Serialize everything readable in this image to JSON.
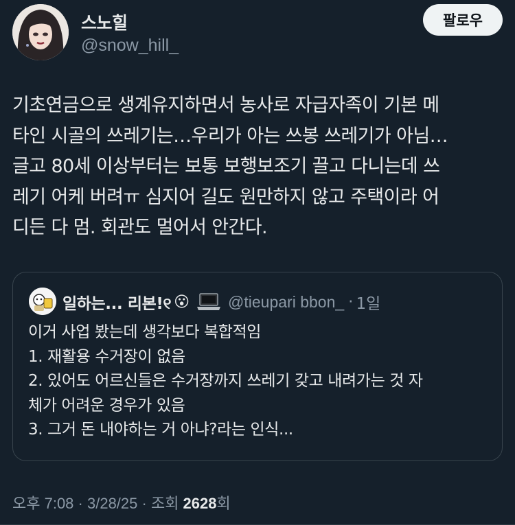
{
  "author": {
    "display_name": "스노힐",
    "handle": "@snow_hill_",
    "follow_label": "팔로우"
  },
  "tweet": {
    "lines": [
      "기초연금으로 생계유지하면서 농사로 자급자족이 기본 메",
      "타인 시골의 쓰레기는…우리가 아는 쓰봉 쓰레기가 아님…",
      "글고 80세 이상부터는 보통 보행보조기 끌고 다니는데 쓰",
      "레기 어케 버려ㅠ 심지어 길도 원만하지 않고 주택이라 어",
      "디든 다 멈. 회관도 멀어서 안간다."
    ]
  },
  "quote": {
    "display_name": "일하는... 리본!୧",
    "emoji": "😮",
    "handle": "@tieupari bbon_",
    "dot": "·",
    "time": "1일",
    "lines": [
      "이거 사업 봤는데 생각보다 복합적임",
      "1. 재활용 수거장이 없음",
      "2. 있어도 어르신들은 수거장까지 쓰레기 갖고 내려가는 것 자",
      "체가 어려운 경우가 있음",
      "3. 그거 돈 내야하는 거 아냐?라는 인식..."
    ]
  },
  "meta": {
    "time": "오후 7:08",
    "sep1": " · ",
    "date": "3/28/25",
    "sep2": " · ",
    "views_label": "조회 ",
    "views_count": "2628",
    "views_suffix": "회"
  }
}
